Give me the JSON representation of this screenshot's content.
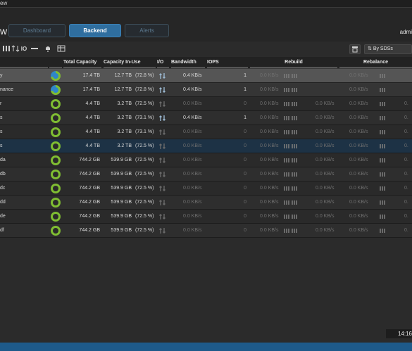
{
  "app": {
    "title_fragment": "ew",
    "view_suffix": "w",
    "user": "admi"
  },
  "tabs": [
    {
      "label": "Dashboard",
      "active": false
    },
    {
      "label": "Backend",
      "active": true
    },
    {
      "label": "Alerts",
      "active": false
    }
  ],
  "toolbar": {
    "icons": [
      "expand-icon",
      "sort-icon",
      "io-icon",
      "minus-icon",
      "bell-icon",
      "grid-icon"
    ],
    "right_icon": "export-icon",
    "by_sdss_label": "By SDSs"
  },
  "columns": {
    "total_capacity": "Total Capacity",
    "capacity_in_use": "Capacity In-Use",
    "io": "I/O",
    "bandwidth": "Bandwidth",
    "iops": "IOPS",
    "rebuild": "Rebuild",
    "rebalance": "Rebalance"
  },
  "rows": [
    {
      "name": "y",
      "total": "17.4 TB",
      "used": "12.7 TB",
      "pct": "(72.8 %)",
      "bw": "0.4 KB/s",
      "iops": "1",
      "rb1": "0.0 KB/s",
      "rb2": "",
      "rl1": "0.0 KB/s",
      "rl2": "",
      "style": "sel",
      "ring": "blue"
    },
    {
      "name": "nance",
      "total": "17.4 TB",
      "used": "12.7 TB",
      "pct": "(72.8 %)",
      "bw": "0.4 KB/s",
      "iops": "1",
      "rb1": "0.0 KB/s",
      "rb2": "",
      "rl1": "0.0 KB/s",
      "rl2": "",
      "style": "sub",
      "ring": "blue"
    },
    {
      "name": "r",
      "total": "4.4 TB",
      "used": "3.2 TB",
      "pct": "(72.5 %)",
      "bw": "0.0 KB/s",
      "iops": "0",
      "rb1": "0.0 KB/s",
      "rb2": "0.0 KB/s",
      "rl1": "0.0 KB/s",
      "rl2": "0.",
      "style": "odd",
      "ring": "green"
    },
    {
      "name": "s",
      "total": "4.4 TB",
      "used": "3.2 TB",
      "pct": "(73.1 %)",
      "bw": "0.4 KB/s",
      "iops": "1",
      "rb1": "0.0 KB/s",
      "rb2": "0.0 KB/s",
      "rl1": "0.0 KB/s",
      "rl2": "0.",
      "style": "even",
      "ring": "green"
    },
    {
      "name": "s",
      "total": "4.4 TB",
      "used": "3.2 TB",
      "pct": "(73.1 %)",
      "bw": "0.0 KB/s",
      "iops": "0",
      "rb1": "0.0 KB/s",
      "rb2": "0.0 KB/s",
      "rl1": "0.0 KB/s",
      "rl2": "0.",
      "style": "odd",
      "ring": "green"
    },
    {
      "name": "s",
      "total": "4.4 TB",
      "used": "3.2 TB",
      "pct": "(72.5 %)",
      "bw": "0.0 KB/s",
      "iops": "0",
      "rb1": "0.0 KB/s",
      "rb2": "0.0 KB/s",
      "rl1": "0.0 KB/s",
      "rl2": "0.",
      "style": "hl",
      "ring": "green"
    },
    {
      "name": "da",
      "total": "744.2 GB",
      "used": "539.9 GB",
      "pct": "(72.5 %)",
      "bw": "0.0 KB/s",
      "iops": "0",
      "rb1": "0.0 KB/s",
      "rb2": "0.0 KB/s",
      "rl1": "0.0 KB/s",
      "rl2": "0.",
      "style": "odd",
      "ring": "green"
    },
    {
      "name": "db",
      "total": "744.2 GB",
      "used": "539.9 GB",
      "pct": "(72.5 %)",
      "bw": "0.0 KB/s",
      "iops": "0",
      "rb1": "0.0 KB/s",
      "rb2": "0.0 KB/s",
      "rl1": "0.0 KB/s",
      "rl2": "0.",
      "style": "even",
      "ring": "green"
    },
    {
      "name": "dc",
      "total": "744.2 GB",
      "used": "539.9 GB",
      "pct": "(72.5 %)",
      "bw": "0.0 KB/s",
      "iops": "0",
      "rb1": "0.0 KB/s",
      "rb2": "0.0 KB/s",
      "rl1": "0.0 KB/s",
      "rl2": "0.",
      "style": "odd",
      "ring": "green"
    },
    {
      "name": "dd",
      "total": "744.2 GB",
      "used": "539.9 GB",
      "pct": "(72.5 %)",
      "bw": "0.0 KB/s",
      "iops": "0",
      "rb1": "0.0 KB/s",
      "rb2": "0.0 KB/s",
      "rl1": "0.0 KB/s",
      "rl2": "0.",
      "style": "even",
      "ring": "green"
    },
    {
      "name": "de",
      "total": "744.2 GB",
      "used": "539.9 GB",
      "pct": "(72.5 %)",
      "bw": "0.0 KB/s",
      "iops": "0",
      "rb1": "0.0 KB/s",
      "rb2": "0.0 KB/s",
      "rl1": "0.0 KB/s",
      "rl2": "0.",
      "style": "odd",
      "ring": "green"
    },
    {
      "name": "df",
      "total": "744.2 GB",
      "used": "539.9 GB",
      "pct": "(72.5 %)",
      "bw": "0.0 KB/s",
      "iops": "0",
      "rb1": "0.0 KB/s",
      "rb2": "0.0 KB/s",
      "rl1": "0.0 KB/s",
      "rl2": "0.",
      "style": "even",
      "ring": "green"
    }
  ],
  "status": {
    "time": "14:16"
  },
  "colors": {
    "accent": "#2f6e9f",
    "ring_green": "#7fbd32",
    "ring_blue": "#2f86c9",
    "footer": "#1e5a8a"
  }
}
